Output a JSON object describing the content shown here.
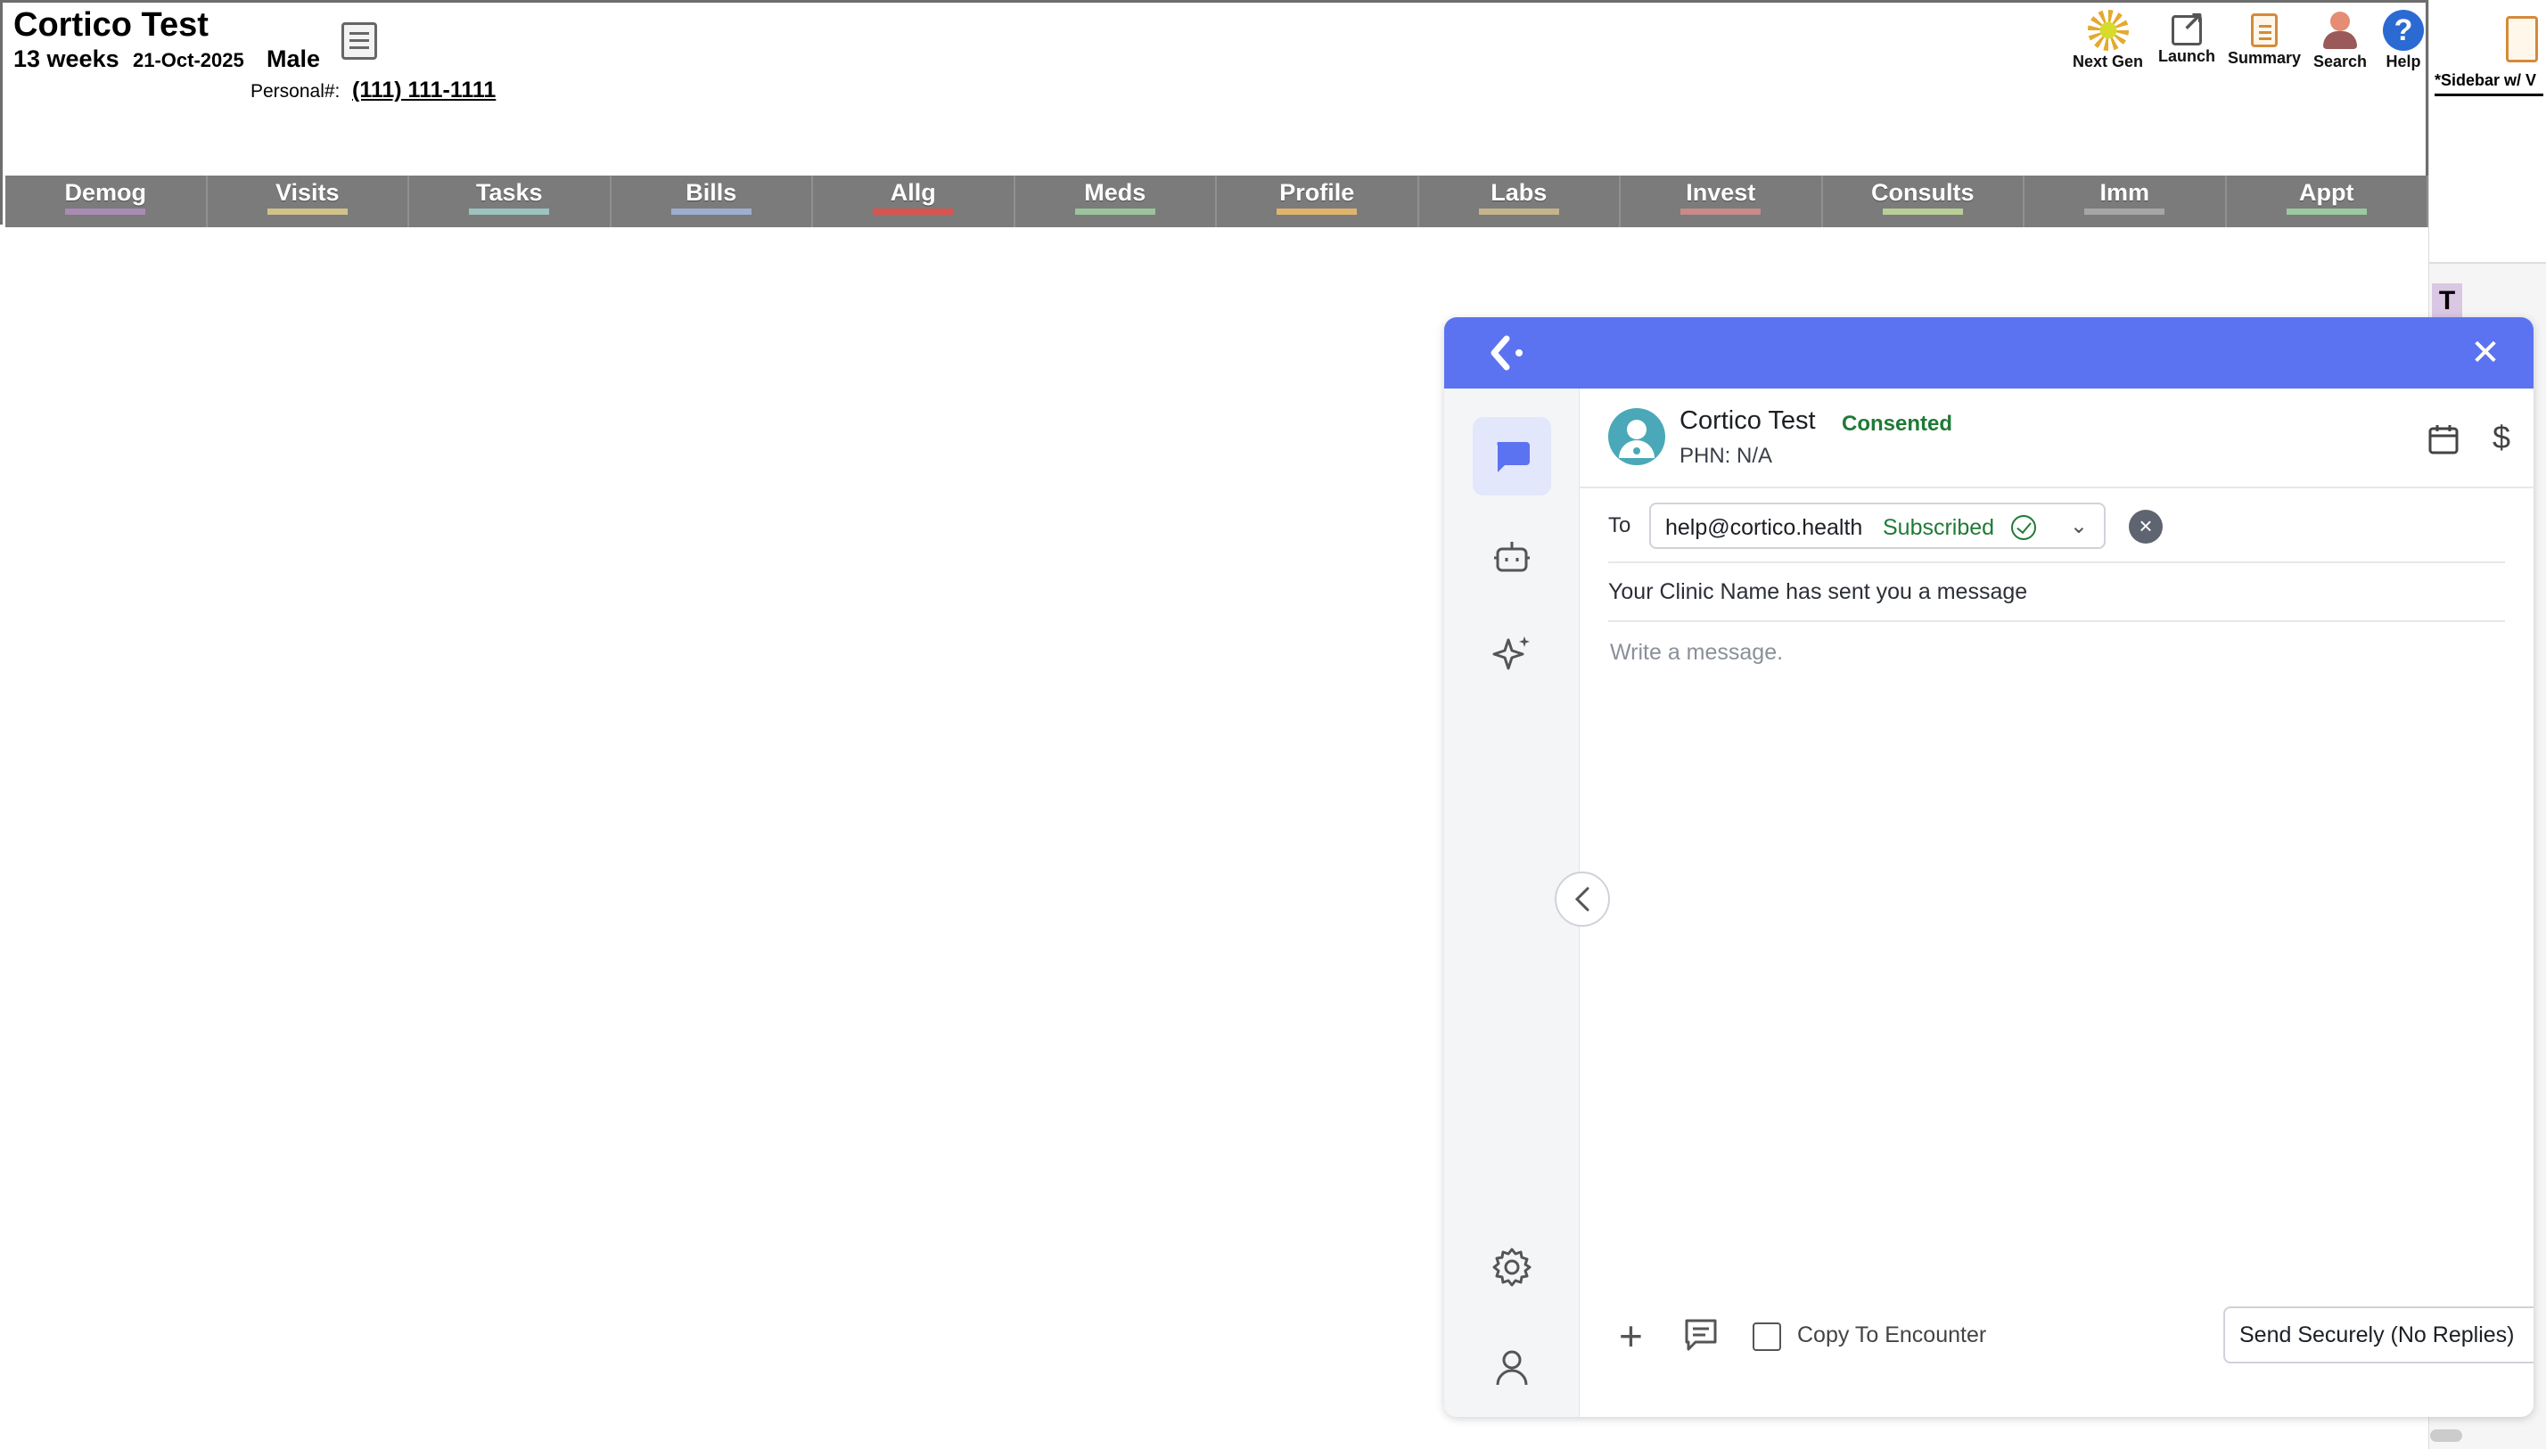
{
  "patient": {
    "name": "Cortico Test",
    "age": "13 weeks",
    "dob": "21-Oct-2025",
    "sex": "Male",
    "personal_label": "Personal#:",
    "phone": "(111) 111-1111"
  },
  "top_tools": [
    {
      "label": "Next Gen",
      "icon": "sunflower-icon"
    },
    {
      "label": "Launch",
      "icon": "launch-icon"
    },
    {
      "label": "Summary",
      "icon": "clipboard-icon"
    },
    {
      "label": "Search",
      "icon": "people-search-icon"
    },
    {
      "label": "Help",
      "icon": "help-icon"
    }
  ],
  "nav_tabs": [
    {
      "label": "Demog",
      "color": "#a98bb5"
    },
    {
      "label": "Visits",
      "color": "#d1c28a"
    },
    {
      "label": "Tasks",
      "color": "#9cc3bf"
    },
    {
      "label": "Bills",
      "color": "#9eaed1"
    },
    {
      "label": "Allg",
      "color": "#d9534f"
    },
    {
      "label": "Meds",
      "color": "#9cc49c"
    },
    {
      "label": "Profile",
      "color": "#e0b56b"
    },
    {
      "label": "Labs",
      "color": "#c4b48a"
    },
    {
      "label": "Invest",
      "color": "#c98a8a"
    },
    {
      "label": "Consults",
      "color": "#b8cf96"
    },
    {
      "label": "Imm",
      "color": "#a6a6a6"
    },
    {
      "label": "Appt",
      "color": "#9cc9a0"
    }
  ],
  "right_strip": {
    "label": "*Sidebar w/ V",
    "tag": "T"
  },
  "cortico": {
    "patient_name": "Cortico Test",
    "consent_status": "Consented",
    "phn": "PHN: N/A",
    "to_label": "To",
    "recipient_email": "help@cortico.health",
    "recipient_status": "Subscribed",
    "subject": "Your Clinic Name has sent you a message",
    "message_placeholder": "Write a message.",
    "message_value": "",
    "copy_to_encounter_label": "Copy To Encounter",
    "send_mode": "Send Securely (No Replies)",
    "accent": "#5b73f0",
    "consent_color": "#1f7a36"
  }
}
